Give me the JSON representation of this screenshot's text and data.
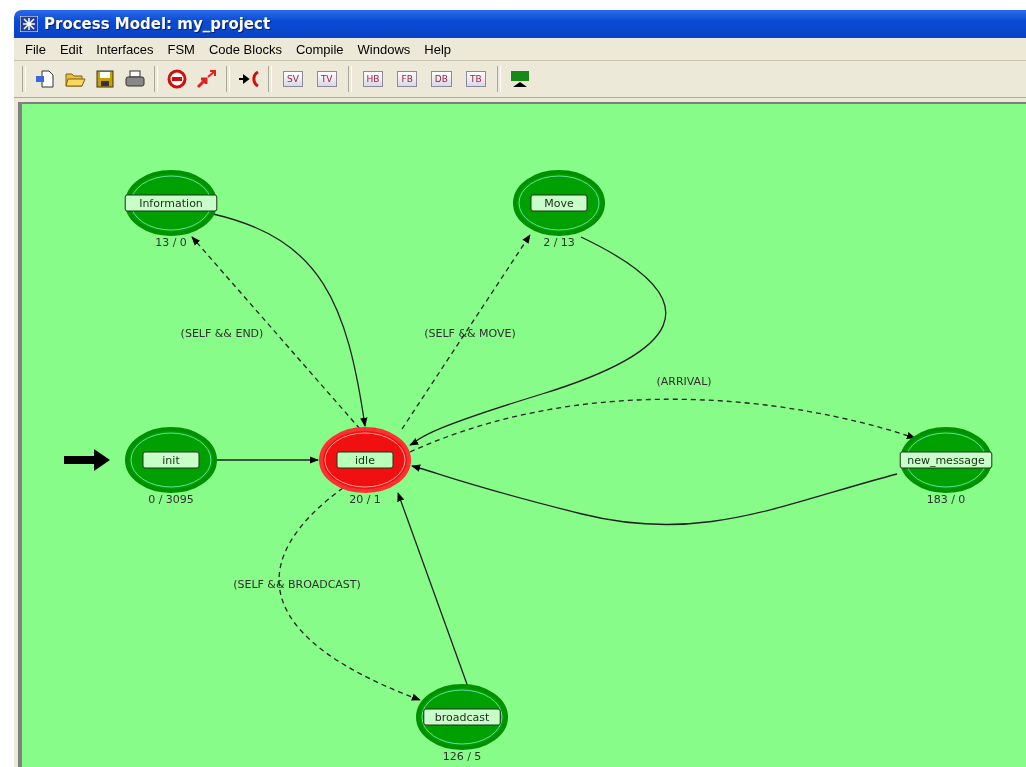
{
  "window": {
    "title": "Process Model: my_project"
  },
  "menu": [
    "File",
    "Edit",
    "Interfaces",
    "FSM",
    "Code Blocks",
    "Compile",
    "Windows",
    "Help"
  ],
  "toolbar": {
    "view_buttons": [
      "SV",
      "TV"
    ],
    "block_buttons": [
      "HB",
      "FB",
      "DB",
      "TB"
    ]
  },
  "states": [
    {
      "name": "Information",
      "count": "13 / 0",
      "forced": true,
      "initial": false
    },
    {
      "name": "Move",
      "count": "2 / 13",
      "forced": true,
      "initial": false
    },
    {
      "name": "init",
      "count": "0 / 3095",
      "forced": true,
      "initial": true
    },
    {
      "name": "idle",
      "count": "20 / 1",
      "forced": false,
      "initial": false
    },
    {
      "name": "new_message",
      "count": "183 / 0",
      "forced": true,
      "initial": false
    },
    {
      "name": "broadcast",
      "count": "126 / 5",
      "forced": true,
      "initial": false
    }
  ],
  "transitions": [
    {
      "kind": "conditional",
      "condition": "(SELF && END)"
    },
    {
      "kind": "unconditional"
    },
    {
      "kind": "conditional",
      "condition": "(SELF && MOVE)"
    },
    {
      "kind": "unconditional"
    },
    {
      "kind": "conditional",
      "condition": "(ARRIVAL)"
    },
    {
      "kind": "unconditional"
    },
    {
      "kind": "unconditional"
    },
    {
      "kind": "conditional",
      "condition": "(SELF && BROADCAST)"
    },
    {
      "kind": "unconditional"
    }
  ]
}
